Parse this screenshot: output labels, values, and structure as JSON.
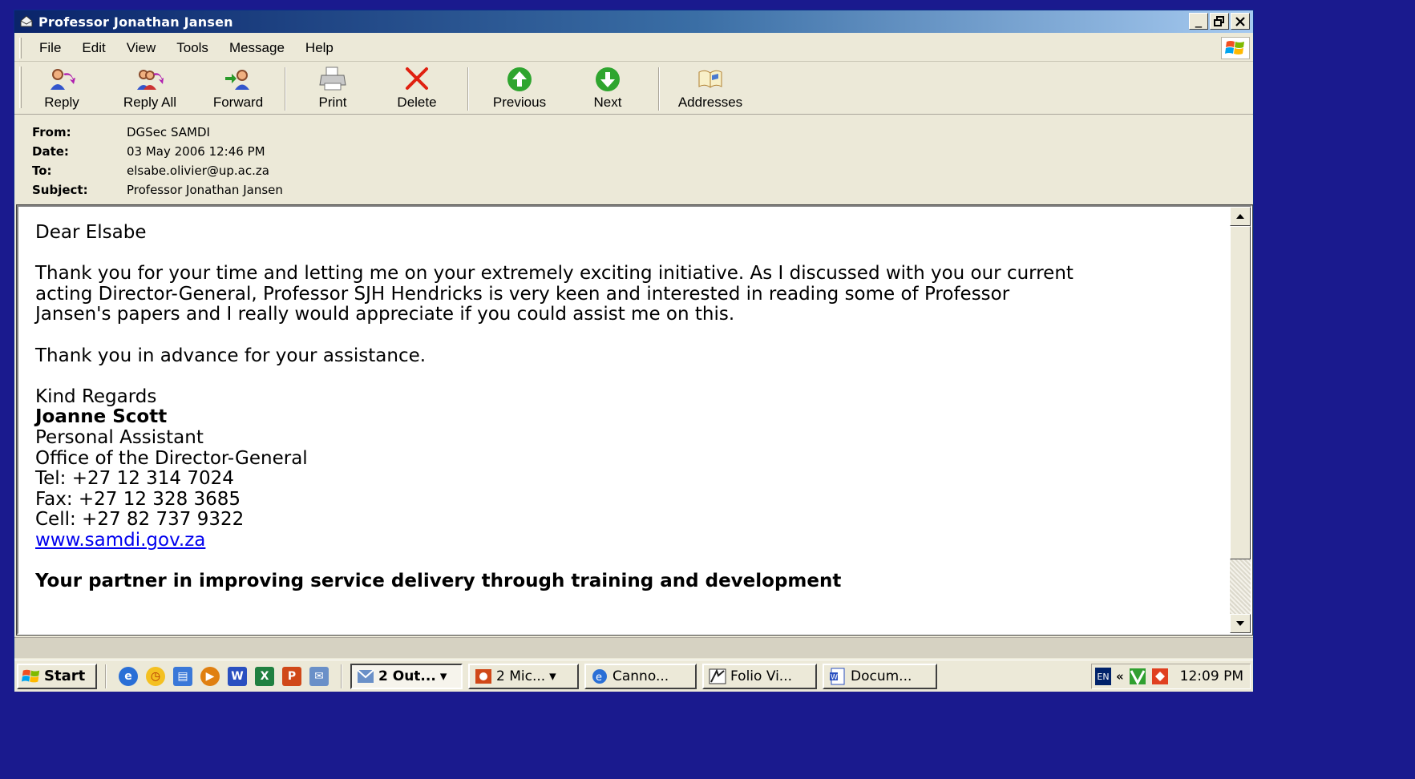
{
  "window": {
    "title": "Professor Jonathan Jansen"
  },
  "menu": [
    "File",
    "Edit",
    "View",
    "Tools",
    "Message",
    "Help"
  ],
  "toolbar": {
    "reply": "Reply",
    "reply_all": "Reply All",
    "forward": "Forward",
    "print": "Print",
    "delete": "Delete",
    "previous": "Previous",
    "next": "Next",
    "addresses": "Addresses"
  },
  "headers": {
    "from_label": "From:",
    "from": "DGSec SAMDI",
    "date_label": "Date:",
    "date": "03 May 2006 12:46 PM",
    "to_label": "To:",
    "to": "elsabe.olivier@up.ac.za",
    "subject_label": "Subject:",
    "subject": "Professor Jonathan Jansen"
  },
  "message": {
    "greeting": "Dear Elsabe",
    "para1_line1": "Thank you for your time and letting me on your extremely exciting initiative.  As I discussed with you our current",
    "para1_line2": "acting Director-General, Professor SJH Hendricks is very keen and interested in reading some of Professor",
    "para1_line3": "Jansen's papers and I really would appreciate if you could assist me on this.",
    "para2": "Thank you in advance for your assistance.",
    "closing": "Kind Regards",
    "signature_name": "Joanne Scott",
    "signature_title": "Personal Assistant",
    "signature_office": "Office of the Director-General",
    "tel": "Tel: +27 12 314 7024",
    "fax": "Fax: +27 12 328 3685",
    "cell": "Cell: +27 82 737 9322",
    "website": "www.samdi.gov.za",
    "tagline": "Your partner in improving service delivery through training and development"
  },
  "taskbar": {
    "start": "Start",
    "tasks": [
      "2 Out...",
      "2 Mic...",
      "Canno...",
      "Folio Vi...",
      "Docum..."
    ],
    "lang": "EN",
    "clock": "12:09 PM"
  },
  "colors": {
    "title_gradient_start": "#0a246a",
    "link": "#0000ee",
    "desktop": "#1a1a8e"
  }
}
